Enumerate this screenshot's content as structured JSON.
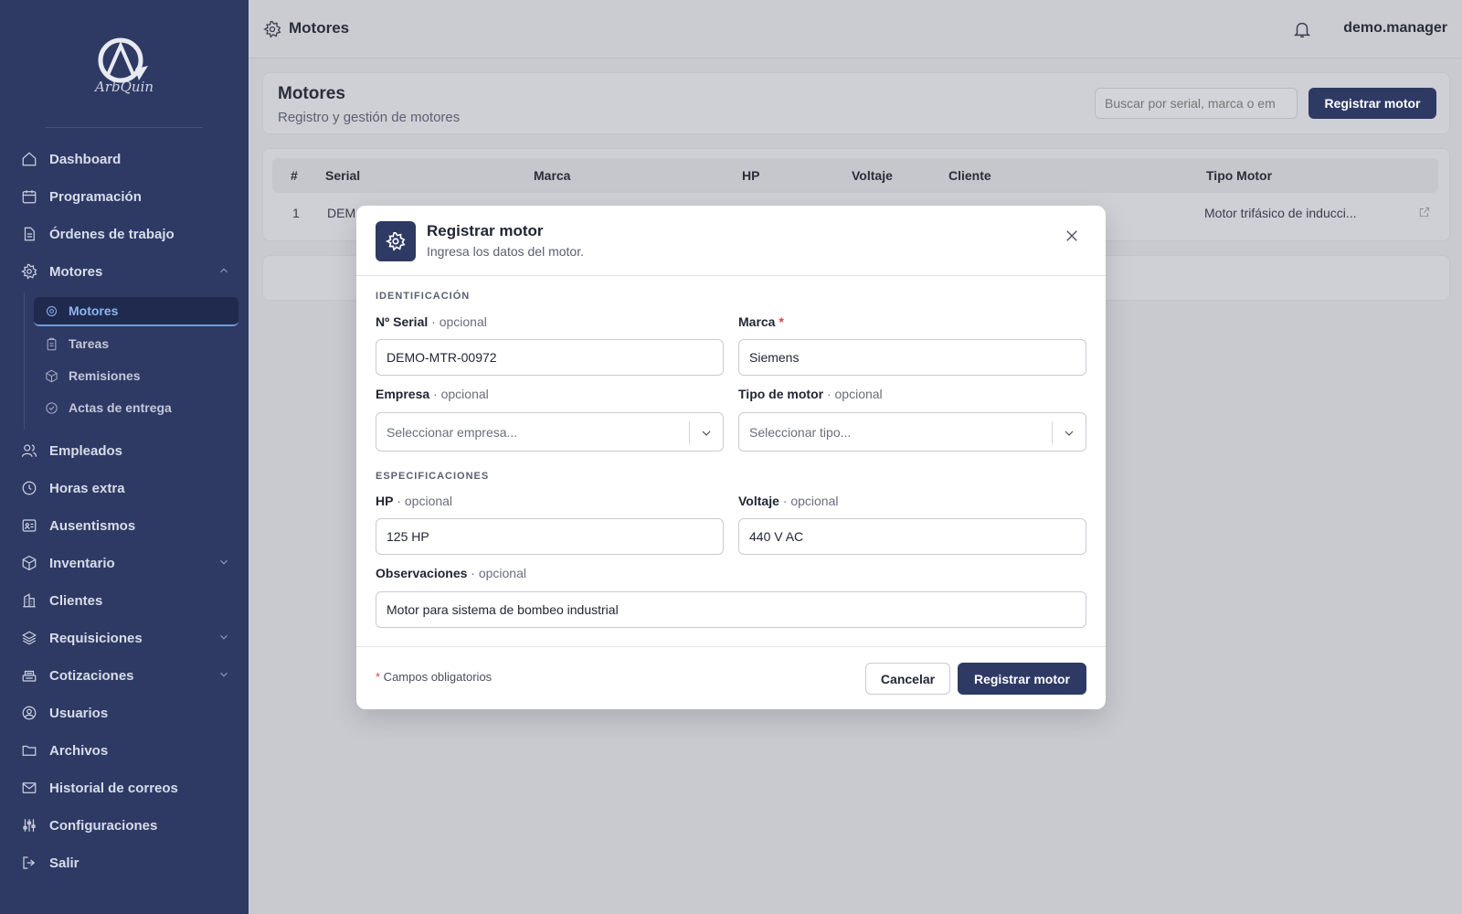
{
  "brand": {
    "name": "ArbQuin"
  },
  "topbar": {
    "title": "Motores",
    "user": "demo.manager"
  },
  "sidebar": {
    "items": [
      {
        "label": "Dashboard",
        "icon": "home-icon"
      },
      {
        "label": "Programación",
        "icon": "calendar-icon"
      },
      {
        "label": "Órdenes de trabajo",
        "icon": "document-icon"
      },
      {
        "label": "Motores",
        "icon": "gear-icon",
        "expanded": true
      },
      {
        "label": "Empleados",
        "icon": "users-icon"
      },
      {
        "label": "Horas extra",
        "icon": "clock-icon"
      },
      {
        "label": "Ausentismos",
        "icon": "id-card-icon"
      },
      {
        "label": "Inventario",
        "icon": "box-icon",
        "collapsible": true
      },
      {
        "label": "Clientes",
        "icon": "building-icon"
      },
      {
        "label": "Requisiciones",
        "icon": "layers-icon",
        "collapsible": true
      },
      {
        "label": "Cotizaciones",
        "icon": "cash-register-icon",
        "collapsible": true
      },
      {
        "label": "Usuarios",
        "icon": "user-circle-icon"
      },
      {
        "label": "Archivos",
        "icon": "folder-icon"
      },
      {
        "label": "Historial de correos",
        "icon": "mail-icon"
      },
      {
        "label": "Configuraciones",
        "icon": "sliders-icon"
      },
      {
        "label": "Salir",
        "icon": "logout-icon"
      }
    ],
    "subitems": [
      {
        "label": "Motores",
        "icon": "gear-icon",
        "active": true
      },
      {
        "label": "Tareas",
        "icon": "clipboard-icon"
      },
      {
        "label": "Remisiones",
        "icon": "package-icon"
      },
      {
        "label": "Actas de entrega",
        "icon": "check-circle-icon"
      }
    ]
  },
  "page": {
    "title": "Motores",
    "subtitle": "Registro y gestión de motores",
    "search_placeholder": "Buscar por serial, marca o em",
    "register_label": "Registrar motor"
  },
  "table": {
    "columns": [
      "#",
      "Serial",
      "Marca",
      "HP",
      "Voltaje",
      "Cliente",
      "Tipo Motor"
    ],
    "rows": [
      {
        "num": "1",
        "serial": "DEM",
        "tipo": "Motor trifásico de inducci..."
      }
    ]
  },
  "modal": {
    "title": "Registrar motor",
    "subtitle": "Ingresa los datos del motor.",
    "section_identificacion": "IDENTIFICACIÓN",
    "section_especificaciones": "ESPECIFICACIONES",
    "fields": {
      "serial": {
        "label": "Nº Serial",
        "optional": " · opcional",
        "value": "DEMO-MTR-00972"
      },
      "marca": {
        "label": "Marca",
        "required": " *",
        "value": "Siemens"
      },
      "empresa": {
        "label": "Empresa",
        "optional": " · opcional",
        "placeholder": "Seleccionar empresa..."
      },
      "tipo": {
        "label": "Tipo de motor",
        "optional": " · opcional",
        "placeholder": "Seleccionar tipo..."
      },
      "hp": {
        "label": "HP",
        "optional": " · opcional",
        "value": "125 HP"
      },
      "voltaje": {
        "label": "Voltaje",
        "optional": " · opcional",
        "value": "440 V AC"
      },
      "observaciones": {
        "label": "Observaciones",
        "optional": " · opcional",
        "value": "Motor para sistema de bombeo industrial"
      }
    },
    "footer_req_mark": "*",
    "footer_note": " Campos obligatorios",
    "cancel_label": "Cancelar",
    "submit_label": "Registrar motor"
  },
  "colors": {
    "primary": "#2e3a64",
    "accent": "#8fb5ef",
    "required": "#d64545"
  }
}
